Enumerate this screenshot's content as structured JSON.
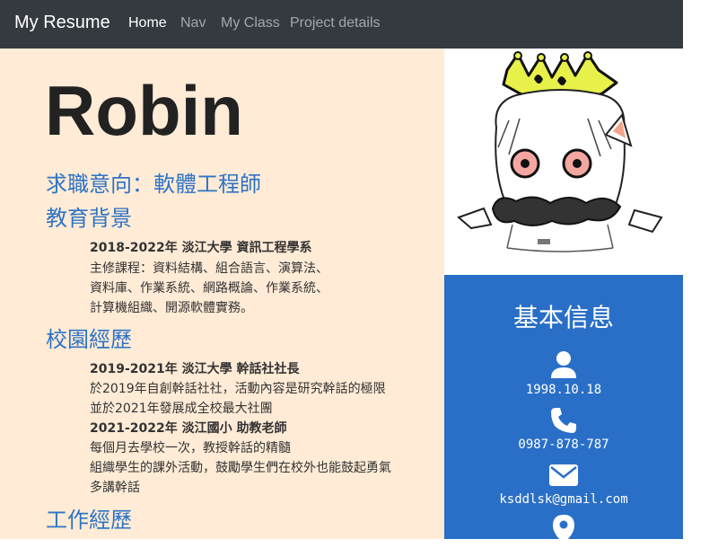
{
  "navbar": {
    "brand": "My Resume",
    "links": [
      "Home",
      "Nav",
      "My Class",
      "Project details"
    ]
  },
  "resume": {
    "name": "Robin",
    "objective": "求職意向：軟體工程師",
    "education": {
      "title": "教育背景",
      "heading": "2018-2022年  淡江大學  資訊工程學系",
      "lines": [
        "主修課程：資料結構、組合語言、演算法、",
        "資料庫、作業系統、網路概論、作業系統、",
        "計算機組織、開源軟體實務。"
      ]
    },
    "campus": {
      "title": "校園經歷",
      "entries": [
        {
          "heading": "2019-2021年  淡江大學  幹話社社長",
          "lines": [
            "於2019年自創幹話社社，活動內容是研究幹話的極限",
            "並於2021年發展成全校最大社團"
          ]
        },
        {
          "heading": "2021-2022年  淡江國小  助教老師",
          "lines": [
            "每個月去學校一次，教授幹話的精髓",
            "組織學生的課外活動，鼓勵學生們在校外也能鼓起勇氣",
            "多講幹話"
          ]
        }
      ]
    },
    "work": {
      "title": "工作經歷"
    }
  },
  "info": {
    "title": "基本信息",
    "birthday": "1998.10.18",
    "phone": "0987-878-787",
    "email": "ksddlsk@gmail.com"
  },
  "icons": {
    "profile": "cartoon-character-crown",
    "birthday": "user-icon",
    "phone": "phone-icon",
    "email": "envelope-icon",
    "location": "map-pin-icon"
  },
  "colors": {
    "navbar": "#343a40",
    "left_bg": "#ffebd6",
    "accent": "#2d74c6",
    "info_bg": "#2a6fc7"
  }
}
